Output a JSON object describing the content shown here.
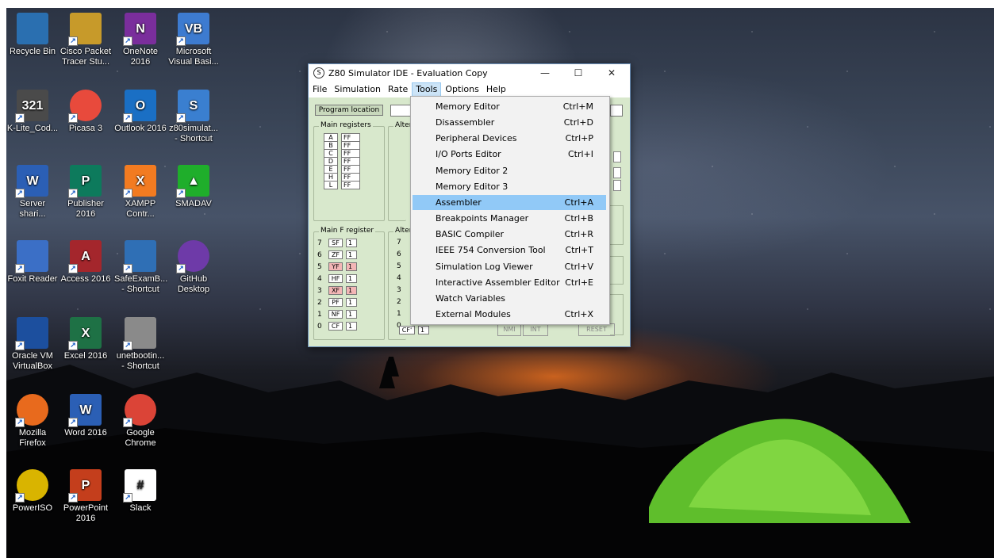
{
  "desktop_icons": [
    {
      "label": "Recycle Bin",
      "icon": "recycle-bin-icon",
      "color": "#2a6fb0"
    },
    {
      "label": "Cisco Packet Tracer Stu...",
      "icon": "cisco-packet-tracer-icon",
      "color": "#c79a2a"
    },
    {
      "label": "OneNote 2016",
      "icon": "onenote-icon",
      "color": "#7a2e9c",
      "glyph": "N"
    },
    {
      "label": "Microsoft Visual Basi...",
      "icon": "visual-basic-icon",
      "color": "#3d7bd0",
      "glyph": "VB"
    },
    {
      "label": "K-Lite_Cod...",
      "icon": "k-lite-codec-icon",
      "color": "#4a4a4a",
      "glyph": "321"
    },
    {
      "label": "Picasa 3",
      "icon": "picasa-icon",
      "color": "#e84a3c"
    },
    {
      "label": "Outlook 2016",
      "icon": "outlook-icon",
      "color": "#1a6fc4",
      "glyph": "O"
    },
    {
      "label": "z80simulat... - Shortcut",
      "icon": "z80-simulator-icon",
      "color": "#3a7fd0",
      "glyph": "S"
    },
    {
      "label": "Server shari...",
      "icon": "word-document-icon",
      "color": "#2b5fb5",
      "glyph": "W"
    },
    {
      "label": "Publisher 2016",
      "icon": "publisher-icon",
      "color": "#0d7a5c",
      "glyph": "P"
    },
    {
      "label": "XAMPP Contr...",
      "icon": "xampp-icon",
      "color": "#f27b21",
      "glyph": "X"
    },
    {
      "label": "SMADAV",
      "icon": "smadav-icon",
      "color": "#1fae2b",
      "glyph": "▲"
    },
    {
      "label": "Foxit Reader",
      "icon": "foxit-reader-icon",
      "color": "#3b6fc6"
    },
    {
      "label": "Access 2016",
      "icon": "access-icon",
      "color": "#a4262c",
      "glyph": "A"
    },
    {
      "label": "SafeExamB... - Shortcut",
      "icon": "safe-exam-browser-icon",
      "color": "#2f6fb5"
    },
    {
      "label": "GitHub Desktop",
      "icon": "github-desktop-icon",
      "color": "#6e3aa8"
    },
    {
      "label": "Oracle VM VirtualBox",
      "icon": "virtualbox-icon",
      "color": "#1c4f9e"
    },
    {
      "label": "Excel 2016",
      "icon": "excel-icon",
      "color": "#1e7145",
      "glyph": "X"
    },
    {
      "label": "unetbootin... - Shortcut",
      "icon": "unetbootin-icon",
      "color": "#8a8a8a"
    },
    {
      "label": "Mozilla Firefox",
      "icon": "firefox-icon",
      "color": "#e86a1d"
    },
    {
      "label": "Word 2016",
      "icon": "word-icon",
      "color": "#2b5fb5",
      "glyph": "W"
    },
    {
      "label": "Google Chrome",
      "icon": "chrome-icon",
      "color": "#db4437"
    },
    {
      "label": "PowerISO",
      "icon": "poweriso-icon",
      "color": "#d9b400"
    },
    {
      "label": "PowerPoint 2016",
      "icon": "powerpoint-icon",
      "color": "#c43e1c",
      "glyph": "P"
    },
    {
      "label": "Slack",
      "icon": "slack-icon",
      "color": "#ffffff",
      "glyph": "#"
    }
  ],
  "window": {
    "title": "Z80 Simulator IDE - Evaluation Copy",
    "minimize": "—",
    "maximize": "☐",
    "close": "✕",
    "menus": [
      "File",
      "Simulation",
      "Rate",
      "Tools",
      "Options",
      "Help"
    ],
    "active_menu": "Tools",
    "program_location_label": "Program location",
    "main_registers": {
      "title": "Main registers",
      "rows": [
        [
          "A",
          "FF"
        ],
        [
          "B",
          "FF"
        ],
        [
          "C",
          "FF"
        ],
        [
          "D",
          "FF"
        ],
        [
          "E",
          "FF"
        ],
        [
          "H",
          "FF"
        ],
        [
          "L",
          "FF"
        ]
      ]
    },
    "alt_registers_title": "Alter",
    "main_f_register": {
      "title": "Main F register",
      "rows": [
        [
          "7",
          "SF",
          "1"
        ],
        [
          "6",
          "ZF",
          "1"
        ],
        [
          "5",
          "YF",
          "1"
        ],
        [
          "4",
          "HF",
          "1"
        ],
        [
          "3",
          "XF",
          "1"
        ],
        [
          "2",
          "PF",
          "1"
        ],
        [
          "1",
          "NF",
          "1"
        ],
        [
          "0",
          "CF",
          "1"
        ]
      ],
      "highlight_color": "#f3b6b6"
    },
    "alt_f_register": {
      "title": "Alter",
      "bits": [
        "7",
        "6",
        "5",
        "4",
        "3",
        "2",
        "1",
        "0"
      ],
      "visible_flag": "CF'",
      "visible_value": "1"
    },
    "buttons": {
      "nmi": "NMI",
      "int": "INT",
      "reset": "RESET"
    }
  },
  "tools_menu": [
    {
      "label": "Memory Editor",
      "shortcut": "Ctrl+M"
    },
    {
      "label": "Disassembler",
      "shortcut": "Ctrl+D"
    },
    {
      "label": "Peripheral Devices",
      "shortcut": "Ctrl+P"
    },
    {
      "label": "I/O Ports Editor",
      "shortcut": "Ctrl+I"
    },
    {
      "label": "Memory Editor 2",
      "shortcut": ""
    },
    {
      "label": "Memory Editor 3",
      "shortcut": ""
    },
    {
      "label": "Assembler",
      "shortcut": "Ctrl+A"
    },
    {
      "label": "Breakpoints Manager",
      "shortcut": "Ctrl+B"
    },
    {
      "label": "BASIC Compiler",
      "shortcut": "Ctrl+R"
    },
    {
      "label": "IEEE 754 Conversion Tool",
      "shortcut": "Ctrl+T"
    },
    {
      "label": "Simulation Log Viewer",
      "shortcut": "Ctrl+V"
    },
    {
      "label": "Interactive Assembler Editor",
      "shortcut": "Ctrl+E"
    },
    {
      "label": "Watch Variables",
      "shortcut": ""
    },
    {
      "label": "External Modules",
      "shortcut": "Ctrl+X"
    }
  ],
  "highlighted_menu_item": "Assembler"
}
